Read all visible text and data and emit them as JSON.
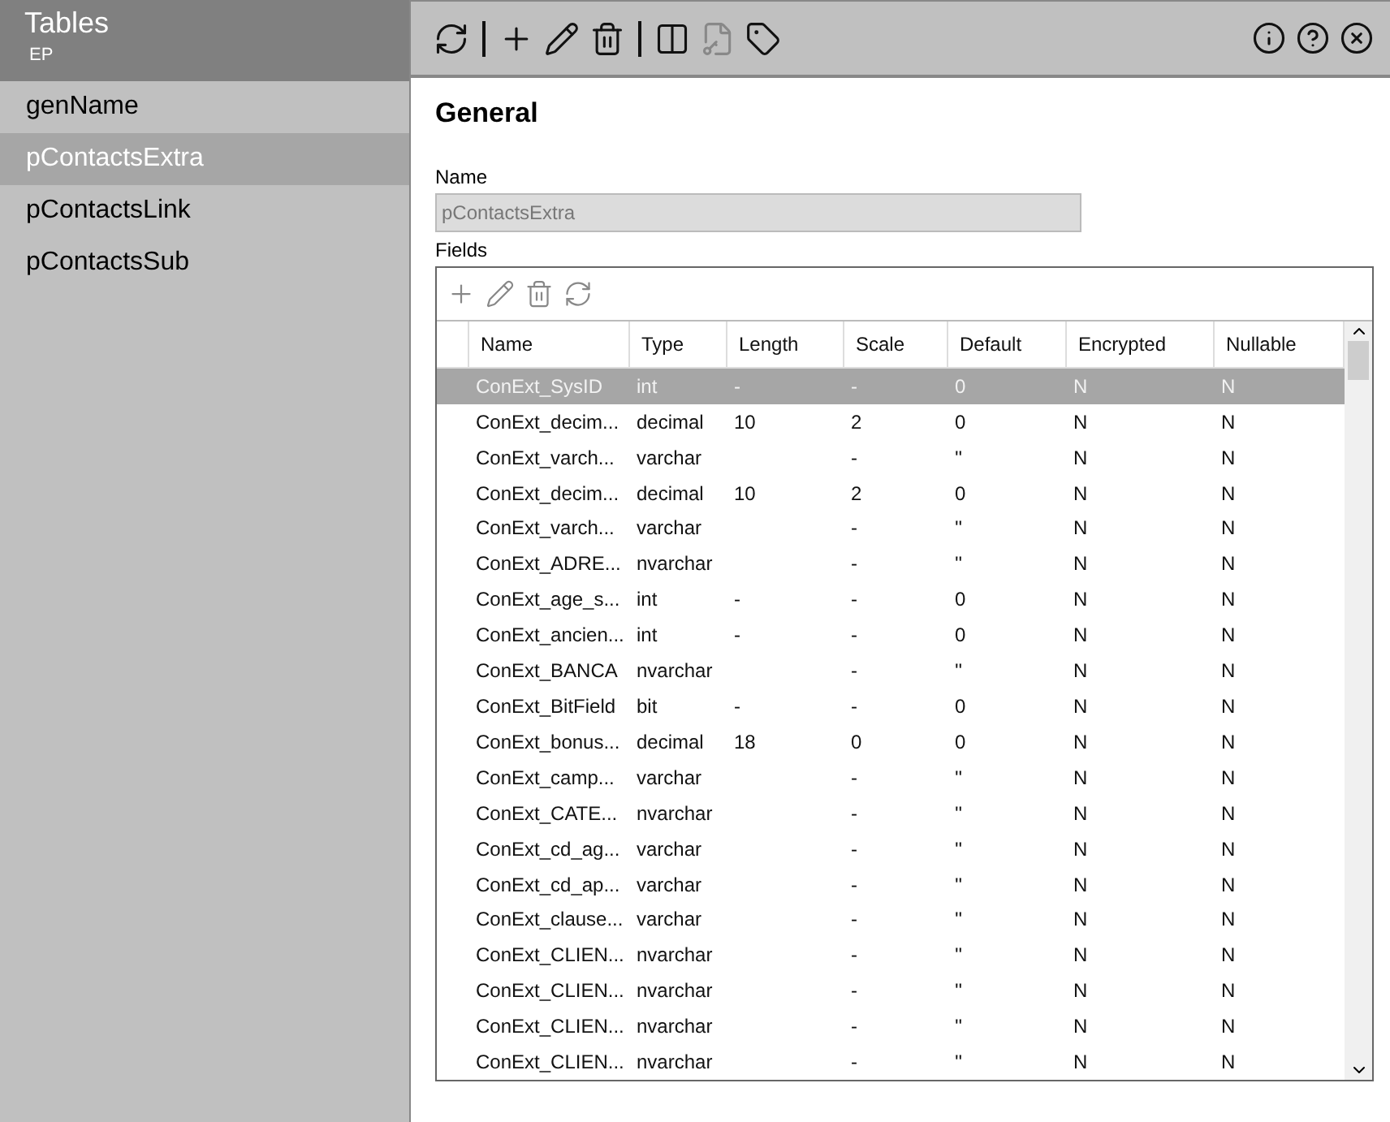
{
  "sidebar": {
    "title": "Tables",
    "subtitle": "EP",
    "items": [
      {
        "label": "genName",
        "selected": false
      },
      {
        "label": "pContactsExtra",
        "selected": true
      },
      {
        "label": "pContactsLink",
        "selected": false
      },
      {
        "label": "pContactsSub",
        "selected": false
      }
    ]
  },
  "toolbar": {
    "tools": [
      {
        "kind": "refresh",
        "disabled": false
      },
      {
        "kind": "divider"
      },
      {
        "kind": "add",
        "disabled": false
      },
      {
        "kind": "edit",
        "disabled": false
      },
      {
        "kind": "delete",
        "disabled": false
      },
      {
        "kind": "divider"
      },
      {
        "kind": "columns",
        "disabled": false
      },
      {
        "kind": "keydoc",
        "disabled": true
      },
      {
        "kind": "tag",
        "disabled": false
      }
    ],
    "actions": [
      {
        "kind": "info"
      },
      {
        "kind": "help"
      },
      {
        "kind": "close"
      }
    ]
  },
  "section_title": "General",
  "name_field": {
    "label": "Name",
    "value": "pContactsExtra",
    "disabled": true
  },
  "fields": {
    "label": "Fields",
    "tools": [
      {
        "kind": "add"
      },
      {
        "kind": "edit"
      },
      {
        "kind": "delete"
      },
      {
        "kind": "refresh"
      }
    ],
    "columns": [
      "Name",
      "Type",
      "Length",
      "Scale",
      "Default",
      "Encrypted",
      "Nullable"
    ],
    "rows": [
      {
        "cells": [
          "ConExt_SysID",
          "int",
          "-",
          "-",
          "0",
          "N",
          "N"
        ],
        "selected": true
      },
      {
        "cells": [
          "ConExt_decim...",
          "decimal",
          "10",
          "2",
          "0",
          "N",
          "N"
        ],
        "selected": false
      },
      {
        "cells": [
          "ConExt_varch...",
          "varchar",
          "",
          "-",
          "''",
          "N",
          "N"
        ],
        "selected": false
      },
      {
        "cells": [
          "ConExt_decim...",
          "decimal",
          "10",
          "2",
          "0",
          "N",
          "N"
        ],
        "selected": false
      },
      {
        "cells": [
          "ConExt_varch...",
          "varchar",
          "",
          "-",
          "''",
          "N",
          "N"
        ],
        "selected": false
      },
      {
        "cells": [
          "ConExt_ADRE...",
          "nvarchar",
          "",
          "-",
          "''",
          "N",
          "N"
        ],
        "selected": false
      },
      {
        "cells": [
          "ConExt_age_s...",
          "int",
          "-",
          "-",
          "0",
          "N",
          "N"
        ],
        "selected": false
      },
      {
        "cells": [
          "ConExt_ancien...",
          "int",
          "-",
          "-",
          "0",
          "N",
          "N"
        ],
        "selected": false
      },
      {
        "cells": [
          "ConExt_BANCA",
          "nvarchar",
          "",
          "-",
          "''",
          "N",
          "N"
        ],
        "selected": false
      },
      {
        "cells": [
          "ConExt_BitField",
          "bit",
          "-",
          "-",
          "0",
          "N",
          "N"
        ],
        "selected": false
      },
      {
        "cells": [
          "ConExt_bonus...",
          "decimal",
          "18",
          "0",
          "0",
          "N",
          "N"
        ],
        "selected": false
      },
      {
        "cells": [
          "ConExt_camp...",
          "varchar",
          "",
          "-",
          "''",
          "N",
          "N"
        ],
        "selected": false
      },
      {
        "cells": [
          "ConExt_CATE...",
          "nvarchar",
          "",
          "-",
          "''",
          "N",
          "N"
        ],
        "selected": false
      },
      {
        "cells": [
          "ConExt_cd_ag...",
          "varchar",
          "",
          "-",
          "''",
          "N",
          "N"
        ],
        "selected": false
      },
      {
        "cells": [
          "ConExt_cd_ap...",
          "varchar",
          "",
          "-",
          "''",
          "N",
          "N"
        ],
        "selected": false
      },
      {
        "cells": [
          "ConExt_clause...",
          "varchar",
          "",
          "-",
          "''",
          "N",
          "N"
        ],
        "selected": false
      },
      {
        "cells": [
          "ConExt_CLIEN...",
          "nvarchar",
          "",
          "-",
          "''",
          "N",
          "N"
        ],
        "selected": false
      },
      {
        "cells": [
          "ConExt_CLIEN...",
          "nvarchar",
          "",
          "-",
          "''",
          "N",
          "N"
        ],
        "selected": false
      },
      {
        "cells": [
          "ConExt_CLIEN...",
          "nvarchar",
          "",
          "-",
          "''",
          "N",
          "N"
        ],
        "selected": false
      },
      {
        "cells": [
          "ConExt_CLIEN...",
          "nvarchar",
          "",
          "-",
          "''",
          "N",
          "N"
        ],
        "selected": false
      }
    ]
  }
}
